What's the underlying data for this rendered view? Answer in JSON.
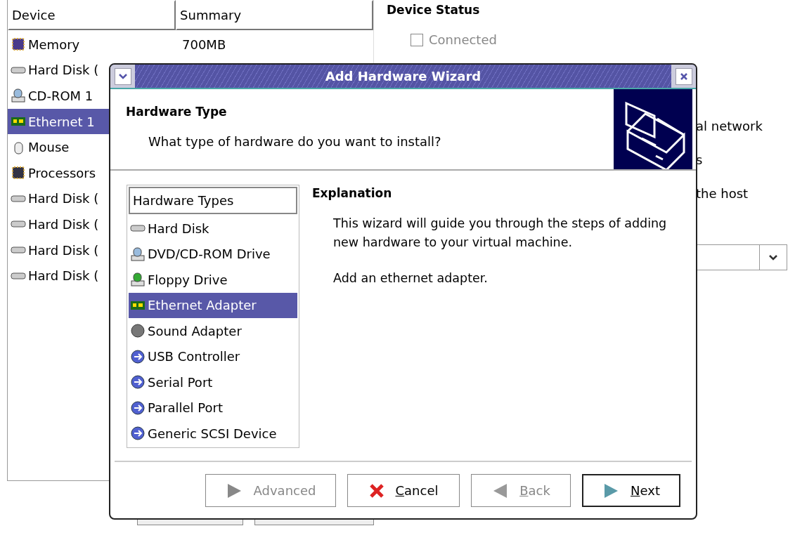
{
  "device_list": {
    "columns": [
      "Device",
      "Summary"
    ],
    "rows": [
      {
        "kind": "memory",
        "device": "Memory",
        "summary": "700MB",
        "selected": false
      },
      {
        "kind": "disk",
        "device": "Hard Disk (",
        "selected": false
      },
      {
        "kind": "cdrom",
        "device": "CD-ROM 1",
        "selected": false
      },
      {
        "kind": "ethernet",
        "device": "Ethernet 1",
        "selected": true
      },
      {
        "kind": "mouse",
        "device": "Mouse",
        "selected": false
      },
      {
        "kind": "processor",
        "device": "Processors",
        "selected": false
      },
      {
        "kind": "disk",
        "device": "Hard Disk (",
        "selected": false
      },
      {
        "kind": "disk",
        "device": "Hard Disk (",
        "selected": false
      },
      {
        "kind": "disk",
        "device": "Hard Disk (",
        "selected": false
      },
      {
        "kind": "disk",
        "device": "Hard Disk (",
        "selected": false
      }
    ]
  },
  "device_status": {
    "title": "Device Status",
    "connected": {
      "label": "Connected",
      "checked": false,
      "disabled": true
    },
    "fragments": [
      "al network",
      "s",
      "the host"
    ]
  },
  "dialog": {
    "title": "Add Hardware Wizard",
    "heading": "Hardware Type",
    "subheading": "What type of hardware do you want to install?",
    "list": {
      "header": "Hardware Types",
      "items": [
        {
          "kind": "disk",
          "label": "Hard Disk",
          "selected": false
        },
        {
          "kind": "cdrom",
          "label": "DVD/CD-ROM Drive",
          "selected": false
        },
        {
          "kind": "floppy",
          "label": "Floppy Drive",
          "selected": false
        },
        {
          "kind": "ethernet",
          "label": "Ethernet Adapter",
          "selected": true
        },
        {
          "kind": "sound",
          "label": "Sound Adapter",
          "selected": false
        },
        {
          "kind": "usb",
          "label": "USB Controller",
          "selected": false
        },
        {
          "kind": "serial",
          "label": "Serial Port",
          "selected": false
        },
        {
          "kind": "parallel",
          "label": "Parallel Port",
          "selected": false
        },
        {
          "kind": "scsi",
          "label": "Generic SCSI Device",
          "selected": false
        }
      ]
    },
    "explanation": {
      "title": "Explanation",
      "paragraphs": [
        "This wizard will guide you through the steps of adding new hardware to your virtual machine.",
        "Add an ethernet adapter."
      ]
    },
    "buttons": [
      {
        "kind": "advanced",
        "label": "Advanced",
        "first_letter_underlined": false,
        "disabled": true,
        "default": false
      },
      {
        "kind": "cancel",
        "label": "Cancel",
        "first_letter_underlined": true,
        "disabled": false,
        "default": false
      },
      {
        "kind": "back",
        "label": "Back",
        "first_letter_underlined": true,
        "disabled": true,
        "default": false
      },
      {
        "kind": "next",
        "label": "Next",
        "first_letter_underlined": true,
        "disabled": false,
        "default": true
      }
    ]
  }
}
